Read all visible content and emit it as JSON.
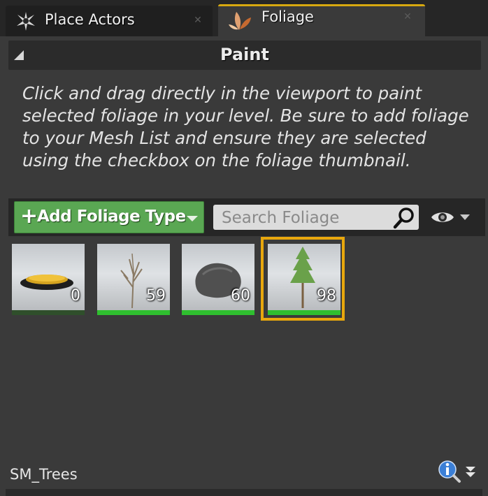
{
  "tabs": [
    {
      "label": "Place Actors",
      "icon": "place-actors-icon",
      "active": false
    },
    {
      "label": "Foliage",
      "icon": "foliage-leaf-icon",
      "active": true
    }
  ],
  "paint_section": {
    "title": "Paint",
    "instructions": "Click and drag directly in the viewport to paint selected foliage in your level. Be sure to add foliage to your Mesh List and ensure they are selected using the checkbox on the foliage thumbnail."
  },
  "toolbar": {
    "add_plus": "+",
    "add_label": "Add Foliage Type",
    "search_placeholder": "Search Foliage",
    "search_value": ""
  },
  "foliage_items": [
    {
      "count": "0",
      "kind": "disc",
      "bar_color": "#2f4f2b",
      "selected": false
    },
    {
      "count": "59",
      "kind": "bare-tree",
      "bar_color": "#2fbf2f",
      "selected": false
    },
    {
      "count": "60",
      "kind": "rock",
      "bar_color": "#2fbf2f",
      "selected": false
    },
    {
      "count": "98",
      "kind": "pine-tree",
      "bar_color": "#2fbf2f",
      "selected": true
    }
  ],
  "footer": {
    "selected_name": "SM_Trees"
  },
  "colors": {
    "accent_tab": "#d7a90f",
    "selection": "#e8a70d",
    "add_button": "#5aa753"
  }
}
